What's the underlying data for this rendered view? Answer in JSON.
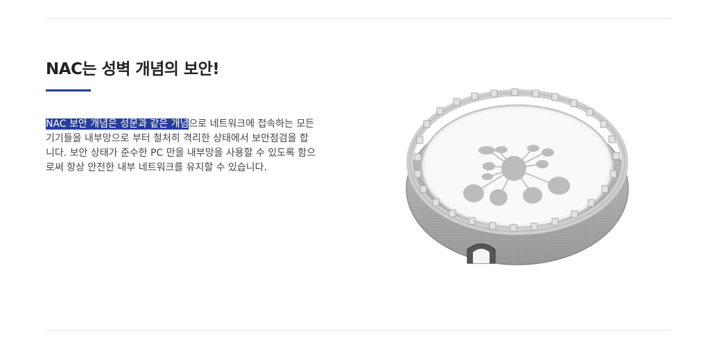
{
  "section": {
    "title": "NAC는 성벽 개념의 보안!",
    "description_highlight": "NAC 보안 개념은 성문과 같은 개념",
    "description_rest": "으로 네트워크에 접속하는 모든 기기들을 내부망으로 부터 철처히 격리한 상태에서 보안점검을 합니다. 보안 상태가 준수한 PC 만을 내부망을 사용할 수 있도록 함으로써 항상 안전한 내부 네트워크를 유지할 수 있습니다."
  },
  "colors": {
    "accent": "#1f3f8f",
    "highlight": "#283d99"
  },
  "illustration": {
    "icon": "fortress-wall-network-icon"
  }
}
